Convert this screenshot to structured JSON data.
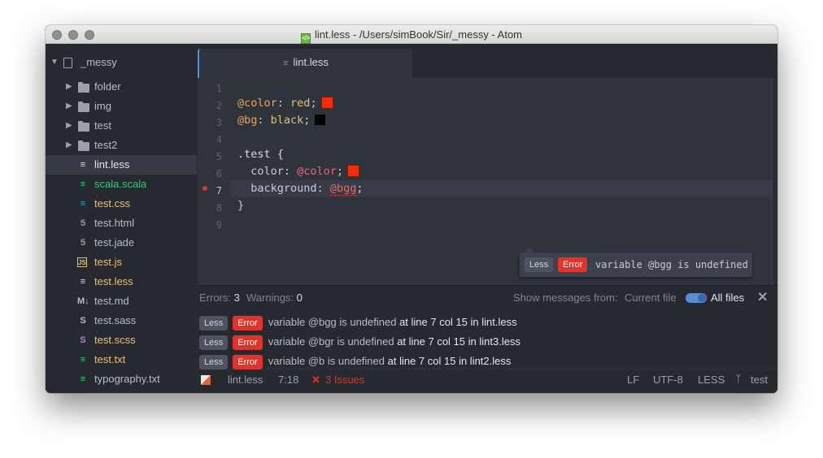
{
  "window": {
    "title": "lint.less - /Users/simBook/Sir/_messy - Atom",
    "title_icon": "less-file-icon"
  },
  "sidebar": {
    "root": {
      "label": "_messy",
      "icon": "repo-icon"
    },
    "items": [
      {
        "label": "folder",
        "type": "folder",
        "color": "#b7bcc6"
      },
      {
        "label": "img",
        "type": "folder",
        "color": "#b7bcc6"
      },
      {
        "label": "test",
        "type": "folder",
        "color": "#b7bcc6"
      },
      {
        "label": "test2",
        "type": "folder",
        "color": "#b7bcc6"
      },
      {
        "label": "lint.less",
        "type": "less",
        "color": "#e4e6ea",
        "selected": true
      },
      {
        "label": "scala.scala",
        "type": "scala",
        "color": "#2ecc71"
      },
      {
        "label": "test.css",
        "type": "css",
        "color": "#e5c07b"
      },
      {
        "label": "test.html",
        "type": "html",
        "color": "#b7bcc6"
      },
      {
        "label": "test.jade",
        "type": "jade",
        "color": "#b7bcc6"
      },
      {
        "label": "test.js",
        "type": "js",
        "color": "#e5c07b"
      },
      {
        "label": "test.less",
        "type": "less",
        "color": "#e5c07b"
      },
      {
        "label": "test.md",
        "type": "md",
        "color": "#b7bcc6"
      },
      {
        "label": "test.sass",
        "type": "sass",
        "color": "#b7bcc6"
      },
      {
        "label": "test.scss",
        "type": "scss",
        "color": "#e5c07b"
      },
      {
        "label": "test.txt",
        "type": "txt",
        "color": "#e5c07b"
      },
      {
        "label": "typography.txt",
        "type": "txt",
        "color": "#b7bcc6"
      }
    ]
  },
  "tab": {
    "label": "lint.less"
  },
  "editor": {
    "line_numbers": [
      "1",
      "2",
      "3",
      "4",
      "5",
      "6",
      "7",
      "8",
      "9"
    ],
    "active_line": "7",
    "lines": {
      "l2_var": "@color",
      "l2_sep": ": ",
      "l2_val": "red",
      "l2_end": ";",
      "l3_var": "@bg",
      "l3_sep": ": ",
      "l3_val": "black",
      "l3_end": ";",
      "l5_sel": ".test {",
      "l6_prop": "  color",
      "l6_sep": ": ",
      "l6_var": "@color",
      "l6_end": ";",
      "l7_prop": "  background",
      "l7_sep": ": ",
      "l7_var": "@bgg",
      "l7_end": ";",
      "l8": "}"
    },
    "swatch_colors": {
      "red": "#ff2a0a",
      "black": "#000000"
    }
  },
  "tooltip": {
    "lang_badge": "Less",
    "severity_badge": "Error",
    "message": "variable @bgg is undefined"
  },
  "panel": {
    "errors_label": "Errors:",
    "errors_count": "3",
    "warnings_label": "Warnings:",
    "warnings_count": "0",
    "show_label": "Show messages from:",
    "option_current": "Current file",
    "option_all": "All files",
    "messages": [
      {
        "lang": "Less",
        "severity": "Error",
        "text": "variable @bgg is undefined",
        "location": "at line 7 col 15 in lint.less"
      },
      {
        "lang": "Less",
        "severity": "Error",
        "text": "variable @bgr is undefined",
        "location": "at line 7 col 15 in lint3.less"
      },
      {
        "lang": "Less",
        "severity": "Error",
        "text": "variable @b is undefined",
        "location": "at line 7 col 15 in lint2.less"
      }
    ]
  },
  "statusbar": {
    "file": "lint.less",
    "cursor": "7:18",
    "issues": "3 Issues",
    "line_ending": "LF",
    "encoding": "UTF-8",
    "grammar": "LESS",
    "branch": "test"
  }
}
